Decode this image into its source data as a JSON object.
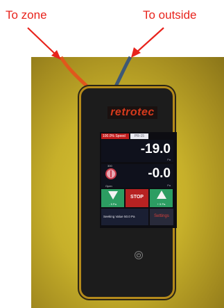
{
  "annotations": {
    "left_label": "To zone",
    "right_label": "To outside"
  },
  "device": {
    "logo": "retrotec",
    "screen": {
      "speed_tab": "100.0% Speed",
      "mode_tab": "PR-15",
      "value1": "-19.0",
      "value1_unit": "Pa",
      "gauge_top": "300",
      "gauge_bottom": "Open",
      "value2": "-0.0",
      "value2_unit": "Pa",
      "down_label": "- 5 Pa",
      "stop_label": "STOP",
      "up_label": "+ 5 Pa",
      "seek_text": "Seeking Value  50.0 Pa",
      "settings_label": "Settings"
    },
    "power_icon": "power-icon"
  },
  "colors": {
    "annotation": "#e8231c",
    "arrow": "#e8231c",
    "hose_orange": "#e0571c",
    "hose_blue": "#3e5876",
    "green_button": "#2c9d62",
    "stop_button": "#b72222",
    "device_body": "#1c1c1c"
  }
}
